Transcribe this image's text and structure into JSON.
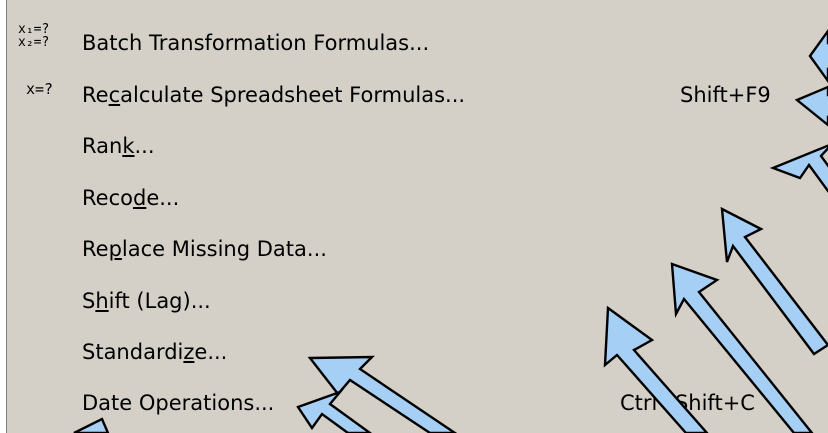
{
  "menu": {
    "items": [
      {
        "parts": [
          "Batch Transformation Formulas..."
        ],
        "shortcut": "",
        "icon": "x1-x2-formula-icon",
        "icon_text_1": "x₁=?",
        "icon_text_2": "x₂=?"
      },
      {
        "parts": [
          "Re",
          "c",
          "alculate Spreadsheet Formulas..."
        ],
        "shortcut": "Shift+F9",
        "icon": "x-formula-icon",
        "icon_text_1": "x=?"
      },
      {
        "parts": [
          "Ran",
          "k",
          "..."
        ],
        "shortcut": ""
      },
      {
        "parts": [
          "Reco",
          "d",
          "e..."
        ],
        "shortcut": ""
      },
      {
        "parts": [
          "Re",
          "p",
          "lace Missing Data..."
        ],
        "shortcut": ""
      },
      {
        "parts": [
          "S",
          "h",
          "ift (Lag)..."
        ],
        "shortcut": ""
      },
      {
        "parts": [
          "Standardi",
          "z",
          "e..."
        ],
        "shortcut": ""
      },
      {
        "parts": [
          "Date Operations..."
        ],
        "shortcut": "Ctrl+Shift+C"
      }
    ]
  },
  "callout_arrows": {
    "count": 8,
    "fill": "#a6cff5",
    "stroke": "#000000"
  },
  "colors": {
    "menu_bg": "#d4d0c8",
    "text": "#000000"
  }
}
